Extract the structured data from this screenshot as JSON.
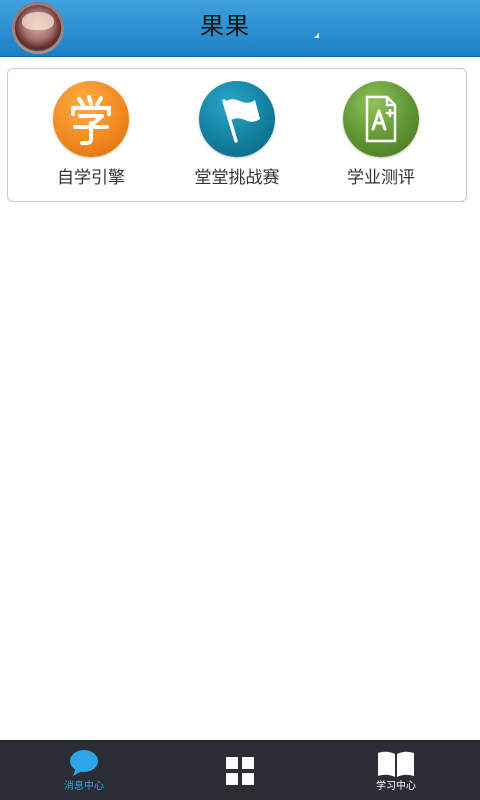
{
  "header": {
    "title": "果果"
  },
  "features": [
    {
      "label": "自学引擎",
      "icon": "self-study-engine-icon",
      "color": "#f28a1f"
    },
    {
      "label": "堂堂挑战赛",
      "icon": "flag-icon",
      "color": "#137f9e"
    },
    {
      "label": "学业测评",
      "icon": "grade-a-plus-icon",
      "color": "#5d9331"
    }
  ],
  "bottom_nav": {
    "messages_label": "消息中心",
    "apps_icon": "grid-icon",
    "study_label": "学习中心"
  },
  "colors": {
    "header_blue": "#2b8fd0",
    "nav_bg": "#2a2d33",
    "nav_active": "#2ca6e8"
  }
}
